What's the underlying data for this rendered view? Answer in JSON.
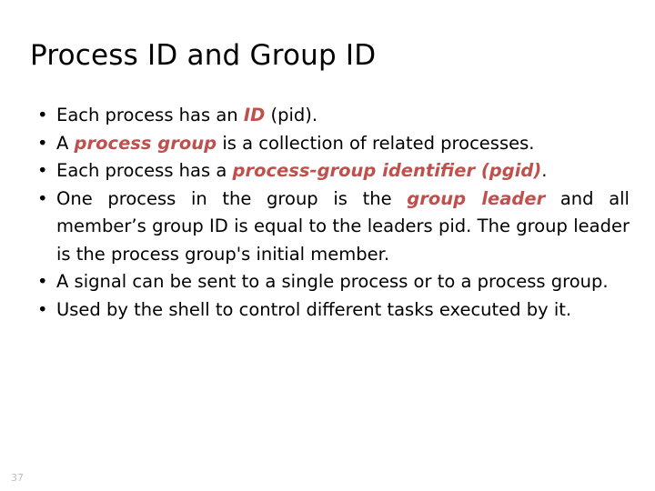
{
  "slide": {
    "title": "Process ID and Group ID",
    "page_number": "37",
    "accent_color": "#C0504D",
    "text_color": "#000000",
    "background_color": "#FFFFFF",
    "bullet_glyph": "•",
    "bullets": [
      {
        "id": "bullet-process-id",
        "parts": [
          {
            "text": "Each process has an ",
            "style": "plain"
          },
          {
            "text": "ID",
            "style": "accent"
          },
          {
            "text": " (pid).",
            "style": "plain"
          }
        ],
        "plain_text": "Each process has an ID (pid)."
      },
      {
        "id": "bullet-process-group",
        "parts": [
          {
            "text": "A ",
            "style": "plain"
          },
          {
            "text": "process group",
            "style": "accent"
          },
          {
            "text": " is a collection of related processes.",
            "style": "plain"
          }
        ],
        "plain_text": "A process group is a collection of related processes."
      },
      {
        "id": "bullet-pgid",
        "parts": [
          {
            "text": "Each process has a ",
            "style": "plain"
          },
          {
            "text": "process-group identifier (pgid)",
            "style": "accent"
          },
          {
            "text": ".",
            "style": "plain"
          }
        ],
        "plain_text": "Each process has a process-group identifier (pgid)."
      },
      {
        "id": "bullet-group-leader",
        "parts": [
          {
            "text": "One process in the group is the ",
            "style": "plain"
          },
          {
            "text": "group leader",
            "style": "accent"
          },
          {
            "text": " and all member’s group ID is equal to the leaders pid. The group leader is the process group's initial member.",
            "style": "plain"
          }
        ],
        "plain_text": "One process in the group is the group leader and all member’s group ID is equal to the leaders pid. The group leader is the process group's initial member."
      },
      {
        "id": "bullet-signal",
        "parts": [
          {
            "text": "A signal can be sent to a single process or to a process group.",
            "style": "plain"
          }
        ],
        "plain_text": "A signal can be sent to a single process or to a process group."
      },
      {
        "id": "bullet-shell",
        "parts": [
          {
            "text": "Used by the shell to control different tasks executed by it.",
            "style": "plain"
          }
        ],
        "plain_text": "Used by the shell to control different tasks executed by it."
      }
    ]
  }
}
